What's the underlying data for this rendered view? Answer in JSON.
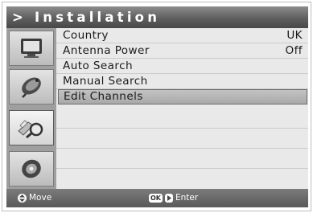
{
  "title": "> Installation",
  "sidebar": {
    "items": [
      {
        "icon": "monitor-icon",
        "active": false
      },
      {
        "icon": "satellite-dish-icon",
        "active": false
      },
      {
        "icon": "magnifier-search-icon",
        "active": true
      },
      {
        "icon": "disc-icon",
        "active": false
      }
    ]
  },
  "menu": {
    "items": [
      {
        "label": "Country",
        "value": "UK"
      },
      {
        "label": "Antenna Power",
        "value": "Off"
      },
      {
        "label": "Auto Search",
        "value": ""
      },
      {
        "label": "Manual Search",
        "value": ""
      },
      {
        "label": "Edit Channels",
        "value": "",
        "selected": true
      }
    ]
  },
  "footer": {
    "move_key_icon": "up-down-arrows-icon",
    "move_label": "Move",
    "ok_key_label": "OK",
    "enter_key_icon": "right-arrow-icon",
    "enter_label": "Enter"
  }
}
